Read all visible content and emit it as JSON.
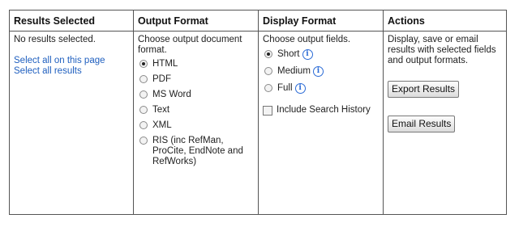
{
  "columns": {
    "results": {
      "header": "Results Selected",
      "status": "No results selected.",
      "select_page": "Select all on this page",
      "select_all": "Select all results"
    },
    "output": {
      "header": "Output Format",
      "prompt": "Choose output document format.",
      "options": [
        {
          "label": "HTML",
          "selected": true
        },
        {
          "label": "PDF",
          "selected": false
        },
        {
          "label": "MS Word",
          "selected": false
        },
        {
          "label": "Text",
          "selected": false
        },
        {
          "label": "XML",
          "selected": false
        },
        {
          "label": "RIS (inc RefMan, ProCite, EndNote and RefWorks)",
          "selected": false
        }
      ]
    },
    "display": {
      "header": "Display Format",
      "prompt": "Choose output fields.",
      "options": [
        {
          "label": "Short",
          "selected": true
        },
        {
          "label": "Medium",
          "selected": false
        },
        {
          "label": "Full",
          "selected": false
        }
      ],
      "history_label": "Include Search History",
      "history_checked": false
    },
    "actions": {
      "header": "Actions",
      "description": "Display, save or email results with selected fields and output formats.",
      "export_label": "Export Results",
      "email_label": "Email Results"
    }
  },
  "icons": {
    "info": "info-icon"
  },
  "colors": {
    "link": "#1f5fbf",
    "info": "#2b6bd6"
  }
}
